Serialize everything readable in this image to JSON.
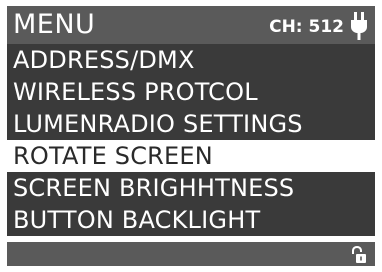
{
  "header": {
    "title": "MENU",
    "channel": "CH: 512",
    "icon": "plug-icon"
  },
  "menu": {
    "items": [
      {
        "label": "ADDRESS/DMX",
        "selected": false
      },
      {
        "label": "WIRELESS PROTCOL",
        "selected": false
      },
      {
        "label": "LUMENRADIO SETTINGS",
        "selected": false
      },
      {
        "label": "ROTATE SCREEN",
        "selected": true
      },
      {
        "label": "SCREEN BRIGHHTNESS",
        "selected": false
      },
      {
        "label": "BUTTON BACKLIGHT",
        "selected": false
      }
    ]
  },
  "footer": {
    "icon": "unlocked-padlock-icon"
  },
  "colors": {
    "header_bg": "#5a5a5a",
    "item_bg": "#3a3a3a",
    "selected_bg": "#ffffff",
    "text": "#ffffff",
    "selected_text": "#2a2a2a"
  }
}
